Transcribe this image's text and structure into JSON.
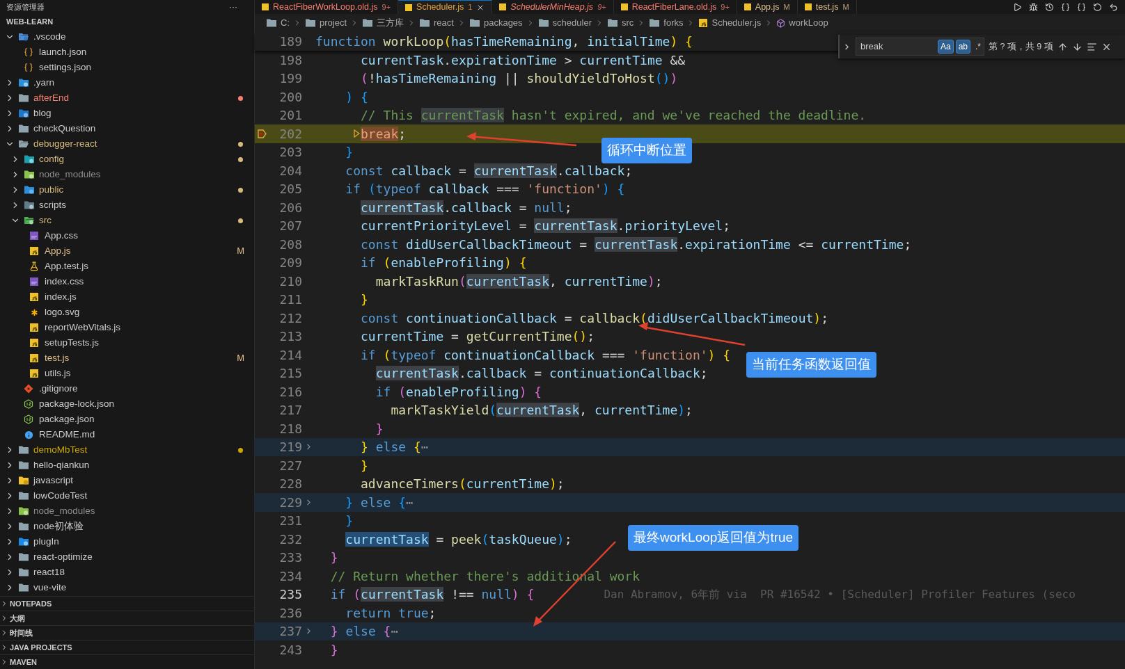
{
  "tabs": [
    {
      "label": "ReactFiberWorkLoop.old.js",
      "badge": "9+",
      "color": "#f88070",
      "selected": false,
      "preview": false
    },
    {
      "label": "Scheduler.js",
      "badge": "1",
      "color": "#e8a23a",
      "selected": true,
      "preview": false
    },
    {
      "label": "SchedulerMinHeap.js",
      "badge": "9+",
      "color": "#f88070",
      "selected": false,
      "preview": true
    },
    {
      "label": "ReactFiberLane.old.js",
      "badge": "9+",
      "color": "#f88070",
      "selected": false,
      "preview": false
    },
    {
      "label": "App.js",
      "badge": "M",
      "color": "#e2c08d",
      "selected": false,
      "preview": false
    },
    {
      "label": "test.js",
      "badge": "M",
      "color": "#e2c08d",
      "selected": false,
      "preview": false
    }
  ],
  "sidebar": {
    "title": "资源管理器",
    "more": "···",
    "workspace": "WEB-LEARN",
    "tree": [
      {
        "label": ".vscode",
        "kind": "folder-vscode",
        "color": "#cccccc",
        "expanded": true,
        "children": [
          {
            "label": "launch.json",
            "kind": "json",
            "color": "#cccccc"
          },
          {
            "label": "settings.json",
            "kind": "json",
            "color": "#cccccc"
          }
        ]
      },
      {
        "label": ".yarn",
        "kind": "folder-yarn",
        "color": "#cccccc",
        "expanded": false
      },
      {
        "label": "afterEnd",
        "kind": "folder",
        "color": "#f88070",
        "expanded": false,
        "dot": true
      },
      {
        "label": "blog",
        "kind": "folder-blog",
        "color": "#cccccc",
        "expanded": false
      },
      {
        "label": "checkQuestion",
        "kind": "folder",
        "color": "#cccccc",
        "expanded": false
      },
      {
        "label": "debugger-react",
        "kind": "folder",
        "color": "#d7ba7d",
        "expanded": true,
        "dot": true,
        "children": [
          {
            "label": "config",
            "kind": "folder-config",
            "color": "#d7ba7d",
            "expanded": false,
            "dot": true
          },
          {
            "label": "node_modules",
            "kind": "folder-node",
            "color": "#8c8c8c",
            "expanded": false
          },
          {
            "label": "public",
            "kind": "folder-public",
            "color": "#d7ba7d",
            "expanded": false,
            "dot": true
          },
          {
            "label": "scripts",
            "kind": "folder-scripts",
            "color": "#cccccc",
            "expanded": false
          },
          {
            "label": "src",
            "kind": "folder-src",
            "color": "#d7ba7d",
            "expanded": true,
            "dot": true,
            "children": [
              {
                "label": "App.css",
                "kind": "css",
                "color": "#cccccc"
              },
              {
                "label": "App.js",
                "kind": "js",
                "color": "#e2c08d",
                "badge": "M"
              },
              {
                "label": "App.test.js",
                "kind": "test",
                "color": "#cccccc"
              },
              {
                "label": "index.css",
                "kind": "css",
                "color": "#cccccc"
              },
              {
                "label": "index.js",
                "kind": "js",
                "color": "#cccccc"
              },
              {
                "label": "logo.svg",
                "kind": "svg",
                "color": "#cccccc"
              },
              {
                "label": "reportWebVitals.js",
                "kind": "js",
                "color": "#cccccc"
              },
              {
                "label": "setupTests.js",
                "kind": "js",
                "color": "#cccccc"
              },
              {
                "label": "test.js",
                "kind": "js",
                "color": "#e2c08d",
                "badge": "M"
              },
              {
                "label": "utils.js",
                "kind": "js",
                "color": "#cccccc"
              }
            ]
          },
          {
            "label": ".gitignore",
            "kind": "git",
            "color": "#cccccc"
          },
          {
            "label": "package-lock.json",
            "kind": "node",
            "color": "#cccccc"
          },
          {
            "label": "package.json",
            "kind": "node",
            "color": "#cccccc"
          },
          {
            "label": "README.md",
            "kind": "info",
            "color": "#cccccc"
          }
        ]
      },
      {
        "label": "demoMbTest",
        "kind": "folder",
        "color": "#cca700",
        "expanded": false,
        "dot": true
      },
      {
        "label": "hello-qiankun",
        "kind": "folder",
        "color": "#cccccc",
        "expanded": false
      },
      {
        "label": "javascript",
        "kind": "folder-js",
        "color": "#cccccc",
        "expanded": false
      },
      {
        "label": "lowCodeTest",
        "kind": "folder",
        "color": "#cccccc",
        "expanded": false
      },
      {
        "label": "node_modules",
        "kind": "folder-node",
        "color": "#8c8c8c",
        "expanded": false
      },
      {
        "label": "node初体验",
        "kind": "folder",
        "color": "#cccccc",
        "expanded": false
      },
      {
        "label": "plugIn",
        "kind": "folder-plugin",
        "color": "#cccccc",
        "expanded": false
      },
      {
        "label": "react-optimize",
        "kind": "folder",
        "color": "#cccccc",
        "expanded": false
      },
      {
        "label": "react18",
        "kind": "folder",
        "color": "#cccccc",
        "expanded": false
      },
      {
        "label": "vue-vite",
        "kind": "folder",
        "color": "#cccccc",
        "expanded": false
      }
    ],
    "sections": [
      {
        "label": "NOTEPADS",
        "expanded": false
      },
      {
        "label": "大纲",
        "expanded": false
      },
      {
        "label": "时间线",
        "expanded": false
      },
      {
        "label": "JAVA PROJECTS",
        "expanded": false
      },
      {
        "label": "MAVEN",
        "expanded": false
      }
    ]
  },
  "breadcrumb": [
    {
      "label": "C:",
      "kind": "folder"
    },
    {
      "label": "project",
      "kind": "folder"
    },
    {
      "label": "三方库",
      "kind": "folder"
    },
    {
      "label": "react",
      "kind": "folder"
    },
    {
      "label": "packages",
      "kind": "folder"
    },
    {
      "label": "scheduler",
      "kind": "folder"
    },
    {
      "label": "src",
      "kind": "folder"
    },
    {
      "label": "forks",
      "kind": "folder"
    },
    {
      "label": "Scheduler.js",
      "kind": "file"
    },
    {
      "label": "workLoop",
      "kind": "symbol"
    }
  ],
  "find": {
    "value": "break",
    "toggles": [
      {
        "label": "Aa",
        "on": true
      },
      {
        "label": "ab",
        "on": true
      },
      {
        "label": ".*",
        "on": false
      }
    ],
    "result": "第 ? 项，共 9 项"
  },
  "sticky": {
    "number": "189",
    "tokens": [
      {
        "kind": "kw",
        "text": "function "
      },
      {
        "kind": "fn",
        "text": "workLoop"
      },
      {
        "kind": "b1",
        "text": "("
      },
      {
        "kind": "var",
        "text": "hasTimeRemaining"
      },
      {
        "kind": "op",
        "text": ", "
      },
      {
        "kind": "var",
        "text": "initialTime"
      },
      {
        "kind": "b1",
        "text": ")"
      },
      {
        "kind": "b1",
        "text": " {"
      }
    ]
  },
  "lines": [
    {
      "number": "198",
      "kind": "code",
      "tokens": [
        {
          "kind": "var",
          "text": "      currentTask"
        },
        {
          "kind": "op",
          "text": "."
        },
        {
          "kind": "var",
          "text": "expirationTime"
        },
        {
          "kind": "op",
          "text": " > "
        },
        {
          "kind": "var",
          "text": "currentTime"
        },
        {
          "kind": "op",
          "text": " &&"
        }
      ]
    },
    {
      "number": "199",
      "kind": "code",
      "tokens": [
        {
          "kind": "b2",
          "text": "      ("
        },
        {
          "kind": "op",
          "text": "!"
        },
        {
          "kind": "var",
          "text": "hasTimeRemaining"
        },
        {
          "kind": "op",
          "text": " || "
        },
        {
          "kind": "fn",
          "text": "shouldYieldToHost"
        },
        {
          "kind": "b3",
          "text": "()"
        },
        {
          "kind": "b2",
          "text": ")"
        }
      ]
    },
    {
      "number": "200",
      "kind": "code",
      "tokens": [
        {
          "kind": "b3",
          "text": "    )"
        },
        {
          "kind": "b3",
          "text": " {"
        }
      ]
    },
    {
      "number": "201",
      "kind": "code",
      "tokens": [
        {
          "kind": "cmt",
          "text": "      // This "
        },
        {
          "kind": "cmtmatch",
          "text": "currentTask"
        },
        {
          "kind": "cmt",
          "text": " hasn't expired, and we've reached the deadline."
        }
      ]
    },
    {
      "number": "202",
      "kind": "paused",
      "tokens": [
        {
          "kind": "find",
          "text": "      break"
        },
        {
          "kind": "op",
          "text": ";"
        }
      ]
    },
    {
      "number": "203",
      "kind": "code",
      "tokens": [
        {
          "kind": "b3",
          "text": "    }"
        }
      ]
    },
    {
      "number": "204",
      "kind": "code",
      "tokens": [
        {
          "kind": "kw",
          "text": "    const "
        },
        {
          "kind": "var",
          "text": "callback"
        },
        {
          "kind": "op",
          "text": " = "
        },
        {
          "kind": "match",
          "text": "currentTask"
        },
        {
          "kind": "op",
          "text": "."
        },
        {
          "kind": "var",
          "text": "callback"
        },
        {
          "kind": "op",
          "text": ";"
        }
      ]
    },
    {
      "number": "205",
      "kind": "code",
      "tokens": [
        {
          "kind": "kw",
          "text": "    if "
        },
        {
          "kind": "b3",
          "text": "("
        },
        {
          "kind": "kw",
          "text": "typeof "
        },
        {
          "kind": "var",
          "text": "callback"
        },
        {
          "kind": "op",
          "text": " === "
        },
        {
          "kind": "str",
          "text": "'function'"
        },
        {
          "kind": "b3",
          "text": ")"
        },
        {
          "kind": "b3",
          "text": " {"
        }
      ]
    },
    {
      "number": "206",
      "kind": "code",
      "tokens": [
        {
          "kind": "match",
          "text": "      currentTask"
        },
        {
          "kind": "op",
          "text": "."
        },
        {
          "kind": "var",
          "text": "callback"
        },
        {
          "kind": "op",
          "text": " = "
        },
        {
          "kind": "kw",
          "text": "null"
        },
        {
          "kind": "op",
          "text": ";"
        }
      ]
    },
    {
      "number": "207",
      "kind": "code",
      "tokens": [
        {
          "kind": "var",
          "text": "      currentPriorityLevel"
        },
        {
          "kind": "op",
          "text": " = "
        },
        {
          "kind": "match",
          "text": "currentTask"
        },
        {
          "kind": "op",
          "text": "."
        },
        {
          "kind": "var",
          "text": "priorityLevel"
        },
        {
          "kind": "op",
          "text": ";"
        }
      ]
    },
    {
      "number": "208",
      "kind": "code",
      "tokens": [
        {
          "kind": "kw",
          "text": "      const "
        },
        {
          "kind": "var",
          "text": "didUserCallbackTimeout"
        },
        {
          "kind": "op",
          "text": " = "
        },
        {
          "kind": "match",
          "text": "currentTask"
        },
        {
          "kind": "op",
          "text": "."
        },
        {
          "kind": "var",
          "text": "expirationTime"
        },
        {
          "kind": "op",
          "text": " <= "
        },
        {
          "kind": "var",
          "text": "currentTime"
        },
        {
          "kind": "op",
          "text": ";"
        }
      ]
    },
    {
      "number": "209",
      "kind": "code",
      "tokens": [
        {
          "kind": "kw",
          "text": "      if "
        },
        {
          "kind": "b1",
          "text": "("
        },
        {
          "kind": "var",
          "text": "enableProfiling"
        },
        {
          "kind": "b1",
          "text": ")"
        },
        {
          "kind": "b1",
          "text": " {"
        }
      ]
    },
    {
      "number": "210",
      "kind": "code",
      "tokens": [
        {
          "kind": "fn",
          "text": "        markTaskRun"
        },
        {
          "kind": "b2",
          "text": "("
        },
        {
          "kind": "match",
          "text": "currentTask"
        },
        {
          "kind": "op",
          "text": ", "
        },
        {
          "kind": "var",
          "text": "currentTime"
        },
        {
          "kind": "b2",
          "text": ")"
        },
        {
          "kind": "op",
          "text": ";"
        }
      ]
    },
    {
      "number": "211",
      "kind": "code",
      "tokens": [
        {
          "kind": "b1",
          "text": "      }"
        }
      ]
    },
    {
      "number": "212",
      "kind": "code",
      "tokens": [
        {
          "kind": "kw",
          "text": "      const "
        },
        {
          "kind": "var",
          "text": "continuationCallback"
        },
        {
          "kind": "op",
          "text": " = "
        },
        {
          "kind": "fn",
          "text": "callback"
        },
        {
          "kind": "b1",
          "text": "("
        },
        {
          "kind": "var",
          "text": "didUserCallbackTimeout"
        },
        {
          "kind": "b1",
          "text": ")"
        },
        {
          "kind": "op",
          "text": ";"
        }
      ]
    },
    {
      "number": "213",
      "kind": "code",
      "tokens": [
        {
          "kind": "var",
          "text": "      currentTime"
        },
        {
          "kind": "op",
          "text": " = "
        },
        {
          "kind": "fn",
          "text": "getCurrentTime"
        },
        {
          "kind": "b1",
          "text": "()"
        },
        {
          "kind": "op",
          "text": ";"
        }
      ]
    },
    {
      "number": "214",
      "kind": "code",
      "tokens": [
        {
          "kind": "kw",
          "text": "      if "
        },
        {
          "kind": "b1",
          "text": "("
        },
        {
          "kind": "kw",
          "text": "typeof "
        },
        {
          "kind": "var",
          "text": "continuationCallback"
        },
        {
          "kind": "op",
          "text": " === "
        },
        {
          "kind": "str",
          "text": "'function'"
        },
        {
          "kind": "b1",
          "text": ")"
        },
        {
          "kind": "b1",
          "text": " {"
        }
      ]
    },
    {
      "number": "215",
      "kind": "code",
      "tokens": [
        {
          "kind": "match",
          "text": "        currentTask"
        },
        {
          "kind": "op",
          "text": "."
        },
        {
          "kind": "var",
          "text": "callback"
        },
        {
          "kind": "op",
          "text": " = "
        },
        {
          "kind": "var",
          "text": "continuationCallback"
        },
        {
          "kind": "op",
          "text": ";"
        }
      ]
    },
    {
      "number": "216",
      "kind": "code",
      "tokens": [
        {
          "kind": "kw",
          "text": "        if "
        },
        {
          "kind": "b2",
          "text": "("
        },
        {
          "kind": "var",
          "text": "enableProfiling"
        },
        {
          "kind": "b2",
          "text": ")"
        },
        {
          "kind": "b2",
          "text": " {"
        }
      ]
    },
    {
      "number": "217",
      "kind": "code",
      "tokens": [
        {
          "kind": "fn",
          "text": "          markTaskYield"
        },
        {
          "kind": "b3",
          "text": "("
        },
        {
          "kind": "match",
          "text": "currentTask"
        },
        {
          "kind": "op",
          "text": ", "
        },
        {
          "kind": "var",
          "text": "currentTime"
        },
        {
          "kind": "b3",
          "text": ")"
        },
        {
          "kind": "op",
          "text": ";"
        }
      ]
    },
    {
      "number": "218",
      "kind": "code",
      "tokens": [
        {
          "kind": "b2",
          "text": "        }"
        }
      ]
    },
    {
      "number": "219",
      "kind": "folded",
      "tokens": [
        {
          "kind": "b1",
          "text": "      }"
        },
        {
          "kind": "kw",
          "text": " else "
        },
        {
          "kind": "b1",
          "text": "{"
        },
        {
          "kind": "fold",
          "text": "⋯"
        }
      ]
    },
    {
      "number": "227",
      "kind": "code",
      "tokens": [
        {
          "kind": "b1",
          "text": "      }"
        }
      ]
    },
    {
      "number": "228",
      "kind": "code",
      "tokens": [
        {
          "kind": "fn",
          "text": "      advanceTimers"
        },
        {
          "kind": "b1",
          "text": "("
        },
        {
          "kind": "var",
          "text": "currentTime"
        },
        {
          "kind": "b1",
          "text": ")"
        },
        {
          "kind": "op",
          "text": ";"
        }
      ]
    },
    {
      "number": "229",
      "kind": "folded",
      "tokens": [
        {
          "kind": "b3",
          "text": "    }"
        },
        {
          "kind": "kw",
          "text": " else "
        },
        {
          "kind": "b3",
          "text": "{"
        },
        {
          "kind": "fold",
          "text": "⋯"
        }
      ]
    },
    {
      "number": "231",
      "kind": "code",
      "tokens": [
        {
          "kind": "b3",
          "text": "    }"
        }
      ]
    },
    {
      "number": "232",
      "kind": "code",
      "tokens": [
        {
          "kind": "sel",
          "text": "    currentTask"
        },
        {
          "kind": "op",
          "text": " = "
        },
        {
          "kind": "fn",
          "text": "peek"
        },
        {
          "kind": "b3",
          "text": "("
        },
        {
          "kind": "var",
          "text": "taskQueue"
        },
        {
          "kind": "b3",
          "text": ")"
        },
        {
          "kind": "op",
          "text": ";"
        }
      ]
    },
    {
      "number": "233",
      "kind": "code",
      "tokens": [
        {
          "kind": "b2",
          "text": "  }"
        }
      ]
    },
    {
      "number": "234",
      "kind": "code",
      "tokens": [
        {
          "kind": "cmt",
          "text": "  // Return whether there's additional work"
        }
      ]
    },
    {
      "number": "235",
      "kind": "cursor",
      "blame": "Dan Abramov, 6年前 via  PR #16542 • [Scheduler] Profiler Features (seco",
      "tokens": [
        {
          "kind": "kw",
          "text": "  if "
        },
        {
          "kind": "b2",
          "text": "("
        },
        {
          "kind": "match",
          "text": "currentTask"
        },
        {
          "kind": "op",
          "text": " !== "
        },
        {
          "kind": "kw",
          "text": "null"
        },
        {
          "kind": "b2",
          "text": ")"
        },
        {
          "kind": "b2",
          "text": " {"
        }
      ]
    },
    {
      "number": "236",
      "kind": "code",
      "tokens": [
        {
          "kind": "kw",
          "text": "    return true"
        },
        {
          "kind": "op",
          "text": ";"
        }
      ]
    },
    {
      "number": "237",
      "kind": "folded",
      "tokens": [
        {
          "kind": "b2",
          "text": "  }"
        },
        {
          "kind": "kw",
          "text": " else "
        },
        {
          "kind": "b2",
          "text": "{"
        },
        {
          "kind": "fold",
          "text": "⋯"
        }
      ]
    },
    {
      "number": "243",
      "kind": "code",
      "tokens": [
        {
          "kind": "b2",
          "text": "  }"
        }
      ]
    }
  ],
  "annotations": [
    {
      "text": "循环中断位置"
    },
    {
      "text": "当前任务函数返回值"
    },
    {
      "text": "最终workLoop返回值为true"
    }
  ]
}
